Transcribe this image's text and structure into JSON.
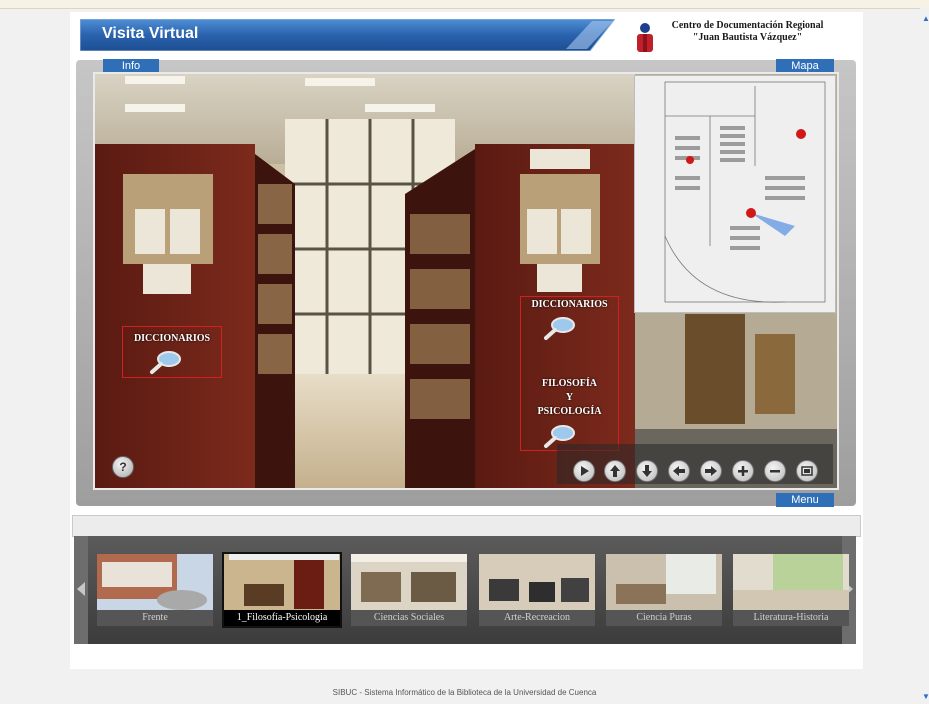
{
  "header": {
    "title": "Visita Virtual",
    "center_line1": "Centro de Documentación Regional",
    "center_line2": "\"Juan Bautista Vázquez\""
  },
  "tabs": {
    "info": "Info",
    "mapa": "Mapa",
    "menu": "Menu"
  },
  "hotspots": [
    {
      "label": "DICCIONARIOS"
    },
    {
      "label": "DICCIONARIOS"
    },
    {
      "label_lines": [
        "FILOSOFÍA",
        "Y",
        "PSICOLOGÍA"
      ]
    }
  ],
  "help_label": "?",
  "controls": [
    "play-icon",
    "arrow-up-icon",
    "arrow-down-icon",
    "arrow-left-icon",
    "arrow-right-icon",
    "zoom-in-icon",
    "zoom-out-icon",
    "fullscreen-icon"
  ],
  "thumbnails": [
    {
      "label": "Frente"
    },
    {
      "label": "1_Filosofía-Psicologia",
      "selected": true
    },
    {
      "label": "Ciencias Sociales"
    },
    {
      "label": "Arte-Recreacion"
    },
    {
      "label": "Ciencia Puras"
    },
    {
      "label": "Literatura-Historia"
    }
  ],
  "footer": "SIBUC - Sistema Informático de la Biblioteca de la Universidad de Cuenca",
  "colors": {
    "header_blue": "#2a63ad",
    "tab_blue": "#2f6fb7",
    "hotspot_red": "#d02020"
  }
}
